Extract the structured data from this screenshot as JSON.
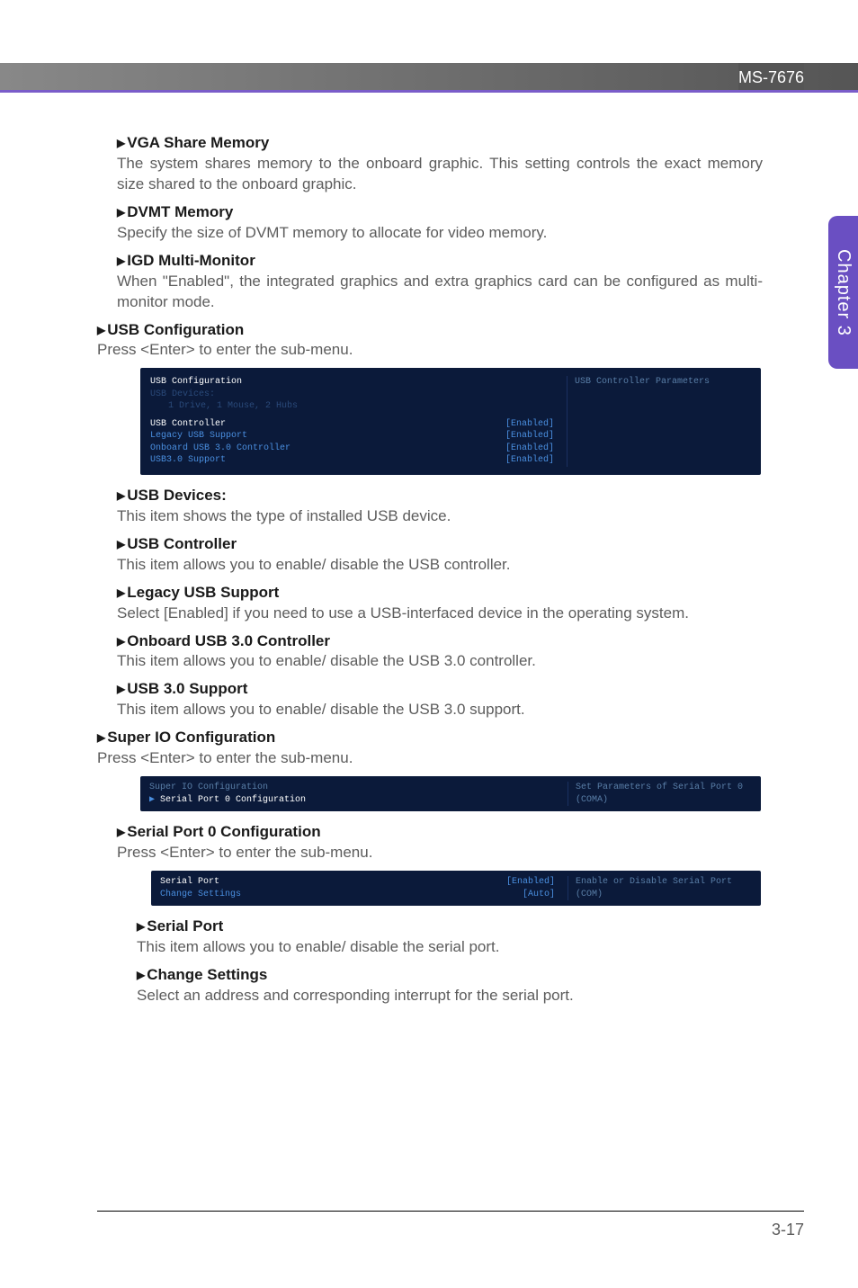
{
  "header": {
    "code": "MS-7676"
  },
  "side_tab": "Chapter 3",
  "page_num": "3-17",
  "sections": {
    "vga": {
      "title": "VGA Share Memory",
      "desc": "The system shares memory to the onboard graphic. This setting controls the exact memory size shared to the onboard graphic."
    },
    "dvmt": {
      "title": "DVMT Memory",
      "desc": "Specify the size of DVMT memory to allocate for video memory."
    },
    "igd": {
      "title": "IGD Multi-Monitor",
      "desc": "When \"Enabled\", the integrated graphics and extra graphics card can be configured as multi-monitor mode."
    },
    "usbcfg": {
      "title": "USB Configuration",
      "desc": "Press <Enter> to enter the sub-menu."
    },
    "usbdev": {
      "title": "USB Devices:",
      "desc": "This item shows the type of installed USB device."
    },
    "usbctrl": {
      "title": "USB Controller",
      "desc": "This item allows you to enable/ disable the USB controller."
    },
    "legacy": {
      "title": "Legacy USB Support",
      "desc": "Select [Enabled] if you need to use a USB-interfaced device in the operating system."
    },
    "onboard": {
      "title": "Onboard USB 3.0 Controller",
      "desc": "This item allows you to enable/ disable the USB 3.0 controller."
    },
    "usb30": {
      "title": "USB 3.0 Support",
      "desc": "This item allows you to enable/ disable the USB 3.0 support."
    },
    "superio": {
      "title": "Super IO Configuration",
      "desc": "Press <Enter> to enter the sub-menu."
    },
    "sp0": {
      "title": "Serial Port 0 Configuration",
      "desc": "Press <Enter> to enter the sub-menu."
    },
    "serialport": {
      "title": "Serial Port",
      "desc": "This item allows you to enable/ disable the serial port."
    },
    "change": {
      "title": "Change Settings",
      "desc": "Select an address and corresponding interrupt for the serial port."
    }
  },
  "bios1": {
    "hdr": "USB Configuration",
    "dev_label": "USB Devices:",
    "dev_line": "1 Drive, 1 Mouse, 2 Hubs",
    "rows": [
      {
        "label": "USB Controller",
        "value": "[Enabled]"
      },
      {
        "label": "Legacy USB Support",
        "value": "[Enabled]"
      },
      {
        "label": "Onboard USB 3.0 Controller",
        "value": "[Enabled]"
      },
      {
        "label": "USB3.0 Support",
        "value": "[Enabled]"
      }
    ],
    "help": "USB Controller Parameters"
  },
  "bios2": {
    "l1": "Super IO Configuration",
    "l2": "Serial Port 0 Configuration",
    "help": "Set Parameters of Serial Port 0 (COMA)"
  },
  "bios3": {
    "rows": [
      {
        "label": "Serial Port",
        "value": "[Enabled]"
      },
      {
        "label": "Change Settings",
        "value": "[Auto]"
      }
    ],
    "help": "Enable or Disable Serial Port (COM)"
  }
}
